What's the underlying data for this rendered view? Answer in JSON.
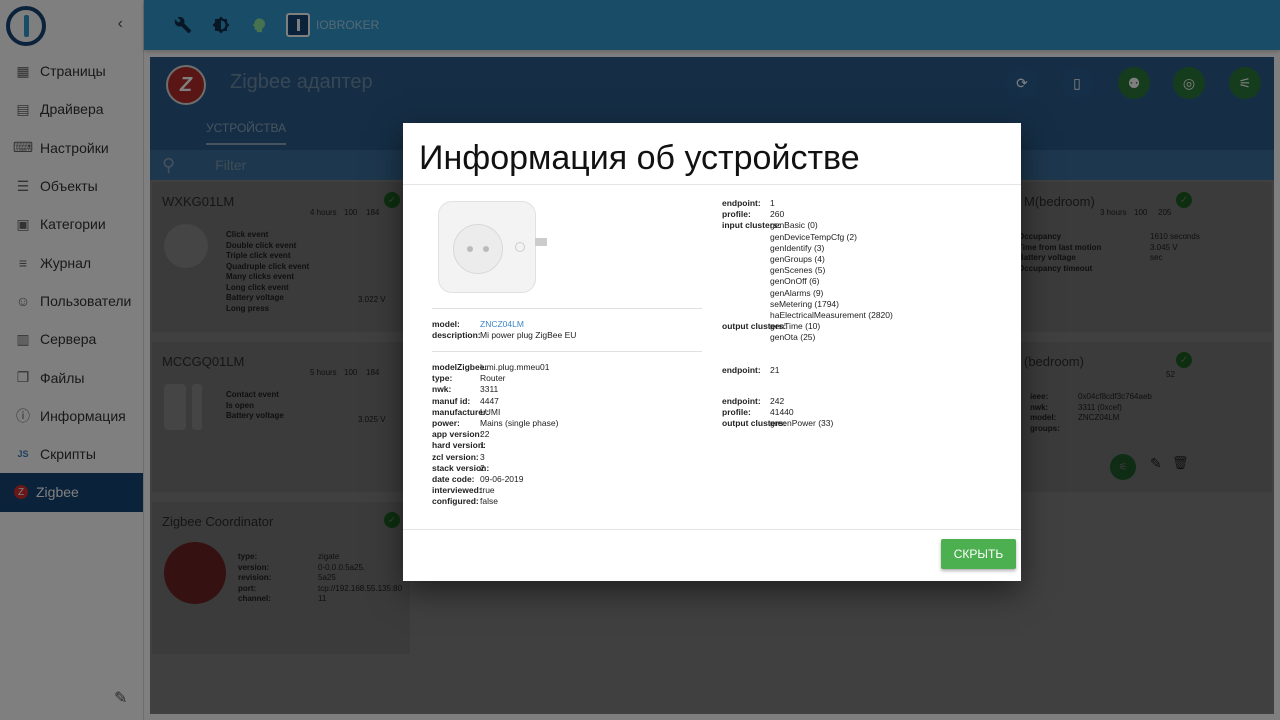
{
  "sidebar": {
    "items": [
      {
        "label": "Страницы",
        "icon": "grid-icon"
      },
      {
        "label": "Драйвера",
        "icon": "store-icon"
      },
      {
        "label": "Настройки",
        "icon": "settings-keyboard-icon"
      },
      {
        "label": "Объекты",
        "icon": "list-icon"
      },
      {
        "label": "Категории",
        "icon": "category-icon"
      },
      {
        "label": "Журнал",
        "icon": "log-icon"
      },
      {
        "label": "Пользователи",
        "icon": "user-icon"
      },
      {
        "label": "Сервера",
        "icon": "server-icon"
      },
      {
        "label": "Файлы",
        "icon": "files-icon"
      },
      {
        "label": "Информация",
        "icon": "info-icon"
      },
      {
        "label": "Скрипты",
        "icon": "js-icon"
      },
      {
        "label": "Zigbee",
        "icon": "zigbee-icon"
      }
    ]
  },
  "topbar": {
    "brand": "IOBROKER"
  },
  "adapter": {
    "title": "Zigbee адаптер",
    "tabs": [
      "УСТРОЙСТВА"
    ],
    "filter_placeholder": "Filter"
  },
  "cards": {
    "wxkg": {
      "title": "WXKG01LM",
      "last_seen": "4 hours",
      "battery": "100",
      "link": "184",
      "events": [
        "Click event",
        "Double click event",
        "Triple click event",
        "Quadruple click event",
        "Many clicks event",
        "Long click event",
        "Battery voltage",
        "Long press"
      ],
      "battery_value": "3.022 V"
    },
    "mccgq": {
      "title": "MCCGQ01LM",
      "last_seen": "5 hours",
      "battery": "100",
      "link": "184",
      "events": [
        "Contact event",
        "Is open",
        "Battery voltage"
      ],
      "battery_value": "3.025 V"
    },
    "coordinator": {
      "title": "Zigbee Coordinator",
      "rows": [
        {
          "k": "type:",
          "v": "zigate"
        },
        {
          "k": "version:",
          "v": "0-0.0.0.5a25."
        },
        {
          "k": "revision:",
          "v": "5a25"
        },
        {
          "k": "port:",
          "v": "tcp://192.168.55.135:80"
        },
        {
          "k": "channel:",
          "v": "11"
        }
      ]
    },
    "right1": {
      "title": "M(bedroom)",
      "last_seen": "3 hours",
      "battery": "100",
      "link": "205",
      "events": [
        "Occupancy",
        "Time from last motion",
        "Battery voltage",
        "Occupancy timeout"
      ],
      "values": [
        "",
        "1610 seconds",
        "3.045 V",
        "sec"
      ]
    },
    "right2": {
      "title": "(bedroom)",
      "link": "52",
      "rows": [
        {
          "k": "ieee:",
          "v": "0x04cf8cdf3c764aeb"
        },
        {
          "k": "nwk:",
          "v": "3311 (0xcef)"
        },
        {
          "k": "model:",
          "v": "ZNCZ04LM"
        },
        {
          "k": "groups:",
          "v": ""
        }
      ]
    }
  },
  "dialog": {
    "title": "Информация об устройстве",
    "left_top": [
      {
        "k": "model:",
        "v": "ZNCZ04LM",
        "link": true
      },
      {
        "k": "description:",
        "v": "Mi power plug ZigBee EU"
      }
    ],
    "left_bottom": [
      {
        "k": "modelZigbee:",
        "v": "lumi.plug.mmeu01"
      },
      {
        "k": "type:",
        "v": "Router"
      },
      {
        "k": "nwk:",
        "v": "3311"
      },
      {
        "k": "manuf id:",
        "v": "4447"
      },
      {
        "k": "manufacturer:",
        "v": "LUMI"
      },
      {
        "k": "power:",
        "v": "Mains (single phase)"
      },
      {
        "k": "app version:",
        "v": "22"
      },
      {
        "k": "hard version:",
        "v": "1"
      },
      {
        "k": "zcl version:",
        "v": "3"
      },
      {
        "k": "stack version:",
        "v": "2"
      },
      {
        "k": "date code:",
        "v": "09-06-2019"
      },
      {
        "k": "interviewed:",
        "v": "true"
      },
      {
        "k": "configured:",
        "v": "false"
      }
    ],
    "ep1": {
      "endpoint": "1",
      "profile": "260",
      "input_clusters": [
        "genBasic (0)",
        "genDeviceTempCfg (2)",
        "genIdentify (3)",
        "genGroups (4)",
        "genScenes (5)",
        "genOnOff (6)",
        "genAlarms (9)",
        "seMetering (1794)",
        "haElectricalMeasurement (2820)"
      ],
      "output_clusters": [
        "genTime (10)",
        "genOta (25)"
      ]
    },
    "ep2": {
      "endpoint": "21"
    },
    "ep3": {
      "endpoint": "242",
      "profile": "41440",
      "output_clusters": [
        "greenPower (33)"
      ]
    },
    "labels": {
      "endpoint": "endpoint:",
      "profile": "profile:",
      "input_clusters": "input clusters:",
      "output_clusters": "output clusters:"
    },
    "hide_button": "СКРЫТЬ"
  },
  "colors": {
    "primary": "#164477",
    "topbar": "#3399cc",
    "success": "#4caf50"
  }
}
